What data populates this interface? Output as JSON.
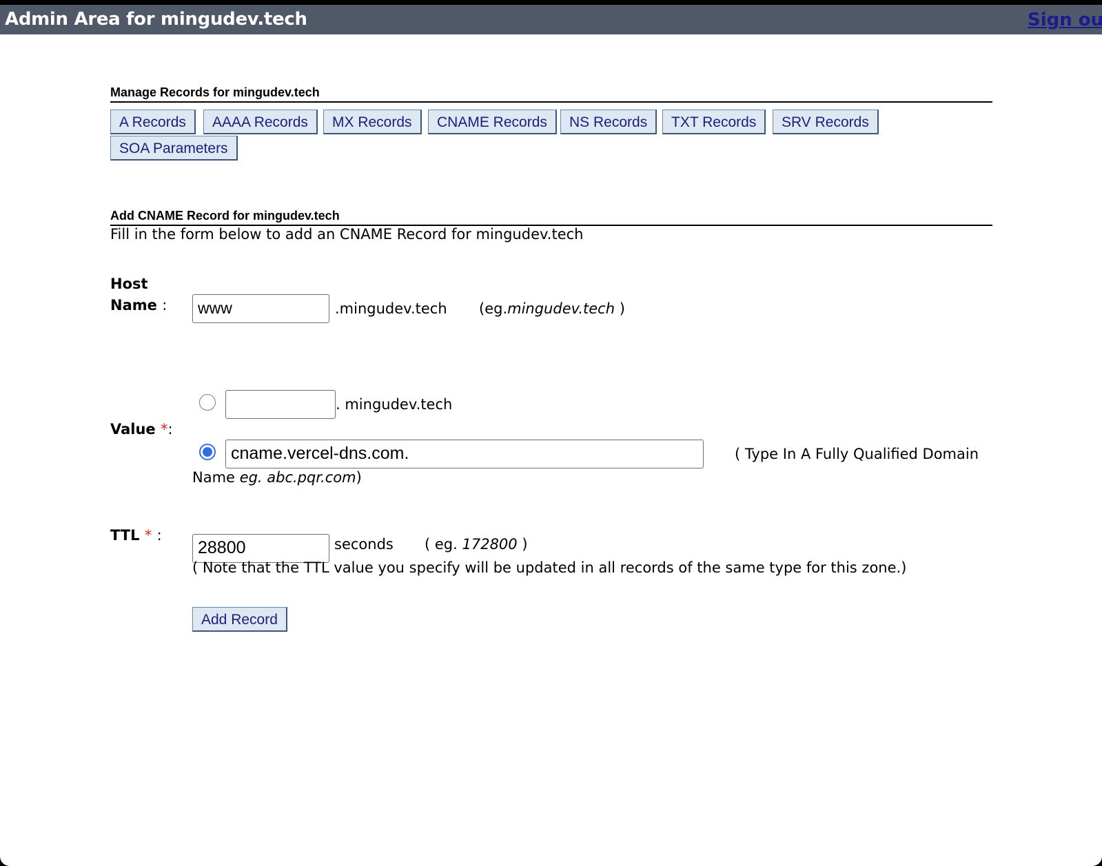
{
  "header": {
    "title": "Admin Area for mingudev.tech",
    "signout_label": "Sign out"
  },
  "manage": {
    "title": "Manage Records for mingudev.tech",
    "tabs": [
      "A Records",
      "AAAA Records",
      "MX Records",
      "CNAME Records",
      "NS Records",
      "TXT Records",
      "SRV Records",
      "SOA Parameters"
    ]
  },
  "form": {
    "title": "Add CNAME Record for mingudev.tech",
    "description": "Fill in the form below to add an CNAME Record for mingudev.tech",
    "host": {
      "label_line1": "Host",
      "label_line2": "Name",
      "colon": ":",
      "value": "www",
      "suffix": ".mingudev.tech",
      "example_prefix": "(eg.",
      "example_value": "mingudev.tech",
      "example_suffix": ")"
    },
    "value": {
      "label": "Value",
      "required_mark": "*",
      "colon": ":",
      "option_subdomain_value": "",
      "option_subdomain_suffix": ". mingudev.tech",
      "option_fqdn_value": "cname.vercel-dns.com.",
      "fqdn_hint_line1": "( Type In A Fully Qualified Domain",
      "fqdn_hint_line2_prefix": "Name",
      "fqdn_hint_example": "eg. abc.pqr.com",
      "fqdn_hint_close": ")",
      "selected": "fqdn"
    },
    "ttl": {
      "label": "TTL",
      "required_mark": "*",
      "colon": ":",
      "value": "28800",
      "unit": "seconds",
      "example_prefix": "( eg.",
      "example_value": "172800",
      "example_suffix": ")",
      "note": "( Note that the TTL value you specify will be updated in all records of the same type for this zone.)"
    },
    "submit_label": "Add Record"
  },
  "colors": {
    "titlebar_bg": "#4f5967",
    "button_bg": "#dde8f2",
    "button_text": "#1b1f7a",
    "required": "#e0261e",
    "radio_selected": "#2f6fe0"
  }
}
